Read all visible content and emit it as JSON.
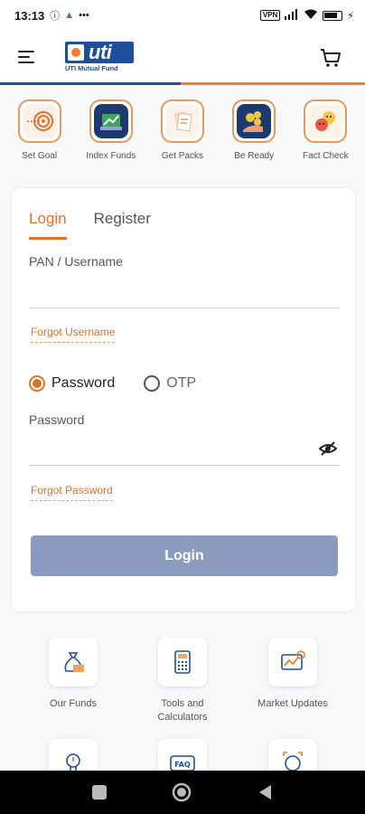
{
  "status_bar": {
    "time": "13:13",
    "vpn_label": "VPN",
    "battery_icon": "battery-icon"
  },
  "header": {
    "menu_icon": "hamburger-icon",
    "logo_text": "uti",
    "logo_subtitle": "UTI Mutual Fund",
    "cart_icon": "cart-icon"
  },
  "quick_actions": [
    {
      "label": "Set Goal",
      "icon": "target-icon"
    },
    {
      "label": "Index Funds",
      "icon": "index-chart-icon"
    },
    {
      "label": "Get Packs",
      "icon": "packs-icon"
    },
    {
      "label": "Be Ready",
      "icon": "coins-hand-icon"
    },
    {
      "label": "Fact Check",
      "icon": "fact-check-icon"
    }
  ],
  "login_card": {
    "tabs": [
      {
        "label": "Login",
        "active": true
      },
      {
        "label": "Register",
        "active": false
      }
    ],
    "username_label": "PAN / Username",
    "username_value": "",
    "forgot_username": "Forgot Username",
    "auth_options": [
      {
        "label": "Password",
        "selected": true
      },
      {
        "label": "OTP",
        "selected": false
      }
    ],
    "password_label": "Password",
    "password_value": "",
    "forgot_password": "Forgot Password",
    "login_button": "Login"
  },
  "features": [
    {
      "label": "Our Funds",
      "icon": "money-bag-icon"
    },
    {
      "label": "Tools and Calculators",
      "icon": "calculator-icon"
    },
    {
      "label": "Market Updates",
      "icon": "market-chart-icon"
    },
    {
      "label": "",
      "icon": "lightbulb-icon"
    },
    {
      "label": "",
      "icon": "faq-icon"
    },
    {
      "label": "",
      "icon": "focus-icon"
    }
  ],
  "colors": {
    "brand_blue": "#1d4f9a",
    "accent_orange": "#e0702a",
    "login_button_disabled": "#8a9bbd"
  }
}
